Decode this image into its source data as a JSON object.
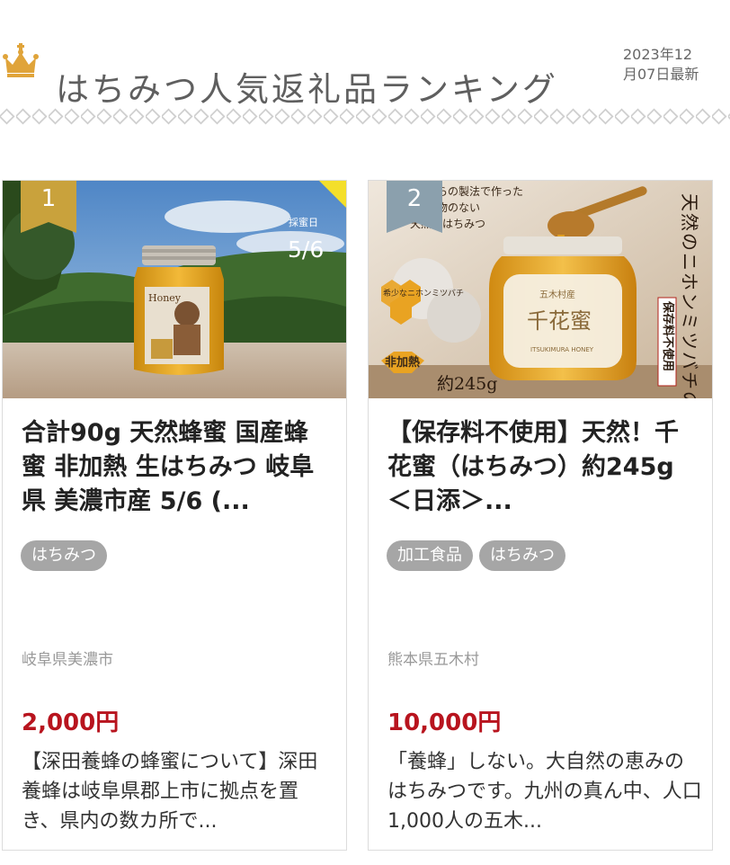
{
  "header": {
    "title": "はちみつ人気返礼品ランキング",
    "updated_line1": "2023年12",
    "updated_line2": "月07日最新",
    "crown_icon": "crown-icon",
    "accent_color": "#e0a43a"
  },
  "items": [
    {
      "rank": "1",
      "rank_color": "#c9a23c",
      "image": {
        "date_label": "採蜜日",
        "date_value": "5/6",
        "jar_label": "Honey"
      },
      "name": "合計90g 天然蜂蜜 国産蜂蜜 非加熱 生はちみつ 岐阜県 美濃市産 5/6 (...",
      "tags": [
        "はちみつ"
      ],
      "location": "岐阜県美濃市",
      "price": "2,000円",
      "description": "【深田養蜂の蜂蜜について】深田養蜂は岐阜県郡上市に拠点を置き、県内の数カ所で..."
    },
    {
      "rank": "2",
      "rank_color": "#8ba0ad",
      "image": {
        "catch_line1": "昔ながらの製法で作った",
        "catch_line2": "添加物のない",
        "catch_line3": "天然のはちみつ",
        "vertical_title": "天然のニホンミツバチのはちみつ",
        "badge_rare": "希少なニホンミツバチ",
        "badge_unheated": "非加熱",
        "weight": "約245g",
        "jar_name": "千花蜜",
        "jar_village": "五木村産",
        "jar_sub": "ITSUKIMURA HONEY",
        "no_preservative": "保存料不使用"
      },
      "name": "【保存料不使用】天然！千花蜜（はちみつ）約245g＜日添＞...",
      "tags": [
        "加工食品",
        "はちみつ"
      ],
      "location": "熊本県五木村",
      "price": "10,000円",
      "description": "「養蜂」しない。大自然の恵みのはちみつです。九州の真ん中、人口1,000人の五木..."
    }
  ]
}
